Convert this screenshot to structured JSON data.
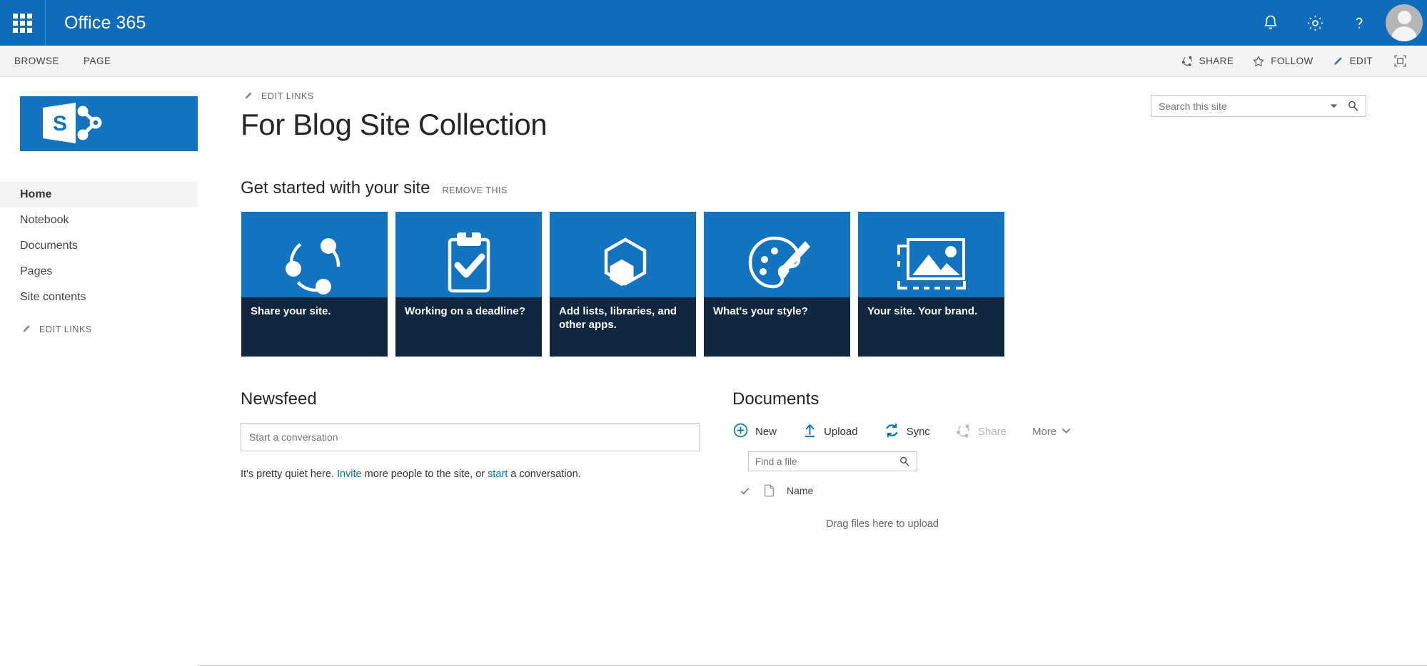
{
  "suite": {
    "brand": "Office 365",
    "waffle_icon": "app-launcher-icon",
    "icons": [
      {
        "name": "notifications-icon",
        "label": "Notifications"
      },
      {
        "name": "settings-gear-icon",
        "label": "Settings"
      },
      {
        "name": "help-icon",
        "label": "?"
      }
    ],
    "avatar": "user-avatar",
    "background": "#0f6cbd"
  },
  "ribbon": {
    "tabs": [
      {
        "label": "BROWSE"
      },
      {
        "label": "PAGE"
      }
    ],
    "actions": [
      {
        "label": "SHARE",
        "icon": "share-icon"
      },
      {
        "label": "FOLLOW",
        "icon": "star-icon"
      },
      {
        "label": "EDIT",
        "icon": "pencil-icon"
      }
    ],
    "focus_label": "Focus on Content",
    "background": "#f4f4f4"
  },
  "sidebar": {
    "logo_alt": "SharePoint logo",
    "items": [
      {
        "label": "Home",
        "selected": true
      },
      {
        "label": "Notebook",
        "selected": false
      },
      {
        "label": "Documents",
        "selected": false
      },
      {
        "label": "Pages",
        "selected": false
      },
      {
        "label": "Site contents",
        "selected": false
      }
    ],
    "edit_links_label": "EDIT LINKS"
  },
  "header": {
    "edit_links_label": "EDIT LINKS",
    "title": "For Blog Site Collection"
  },
  "search": {
    "placeholder": "Search this site",
    "value": ""
  },
  "get_started": {
    "title": "Get started with your site",
    "remove_label": "REMOVE THIS",
    "tiles": [
      {
        "caption": "Share your site.",
        "icon": "share-network-icon"
      },
      {
        "caption": "Working on a deadline?",
        "icon": "clipboard-check-icon"
      },
      {
        "caption": "Add lists, libraries, and other apps.",
        "icon": "hexagon-apps-icon"
      },
      {
        "caption": "What's your style?",
        "icon": "paint-palette-icon"
      },
      {
        "caption": "Your site. Your brand.",
        "icon": "image-crop-icon"
      }
    ],
    "tile_color": "#1273c0",
    "caption_color": "#11263f"
  },
  "newsfeed": {
    "title": "Newsfeed",
    "conversation_placeholder": "Start a conversation",
    "conversation_value": "",
    "empty_prefix": "It's pretty quiet here. ",
    "invite_link": "Invite",
    "empty_middle": " more people to the site, or ",
    "start_link": "start",
    "empty_suffix": " a conversation.",
    "link_color": "#0072c6"
  },
  "documents": {
    "title": "Documents",
    "commands": [
      {
        "label": "New",
        "icon": "plus-circle-icon",
        "disabled": false
      },
      {
        "label": "Upload",
        "icon": "upload-arrow-icon",
        "disabled": false
      },
      {
        "label": "Sync",
        "icon": "sync-icon",
        "disabled": false
      },
      {
        "label": "Share",
        "icon": "share-icon",
        "disabled": true
      }
    ],
    "more_label": "More",
    "find_placeholder": "Find a file",
    "find_value": "",
    "columns": [
      {
        "label": "",
        "icon": "checkmark-icon"
      },
      {
        "label": "",
        "icon": "document-type-icon"
      },
      {
        "label": "Name",
        "icon": ""
      }
    ],
    "dropzone_text": "Drag files here to upload"
  }
}
